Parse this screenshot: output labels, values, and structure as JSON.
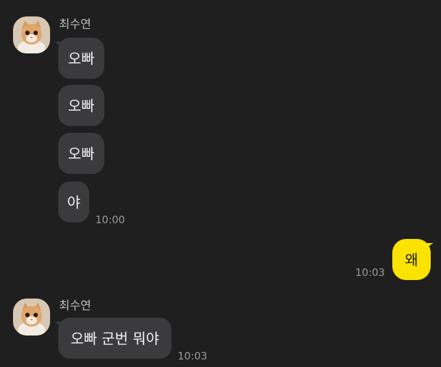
{
  "colors": {
    "background": "#1f1f1f",
    "incoming_bubble": "#3b3b3d",
    "outgoing_bubble": "#fbe300",
    "sender_name": "#bdbdbd",
    "timestamp": "#9a9a9a"
  },
  "groups": [
    {
      "sender": "최수연",
      "avatar_icon": "cat-avatar-icon",
      "messages": [
        "오빠",
        "오빠",
        "오빠",
        "야"
      ],
      "time": "10:00"
    },
    {
      "mine": true,
      "messages": [
        "왜"
      ],
      "time": "10:03"
    },
    {
      "sender": "최수연",
      "avatar_icon": "cat-avatar-icon",
      "messages": [
        "오빠 군번 뭐야"
      ],
      "time": "10:03"
    }
  ]
}
